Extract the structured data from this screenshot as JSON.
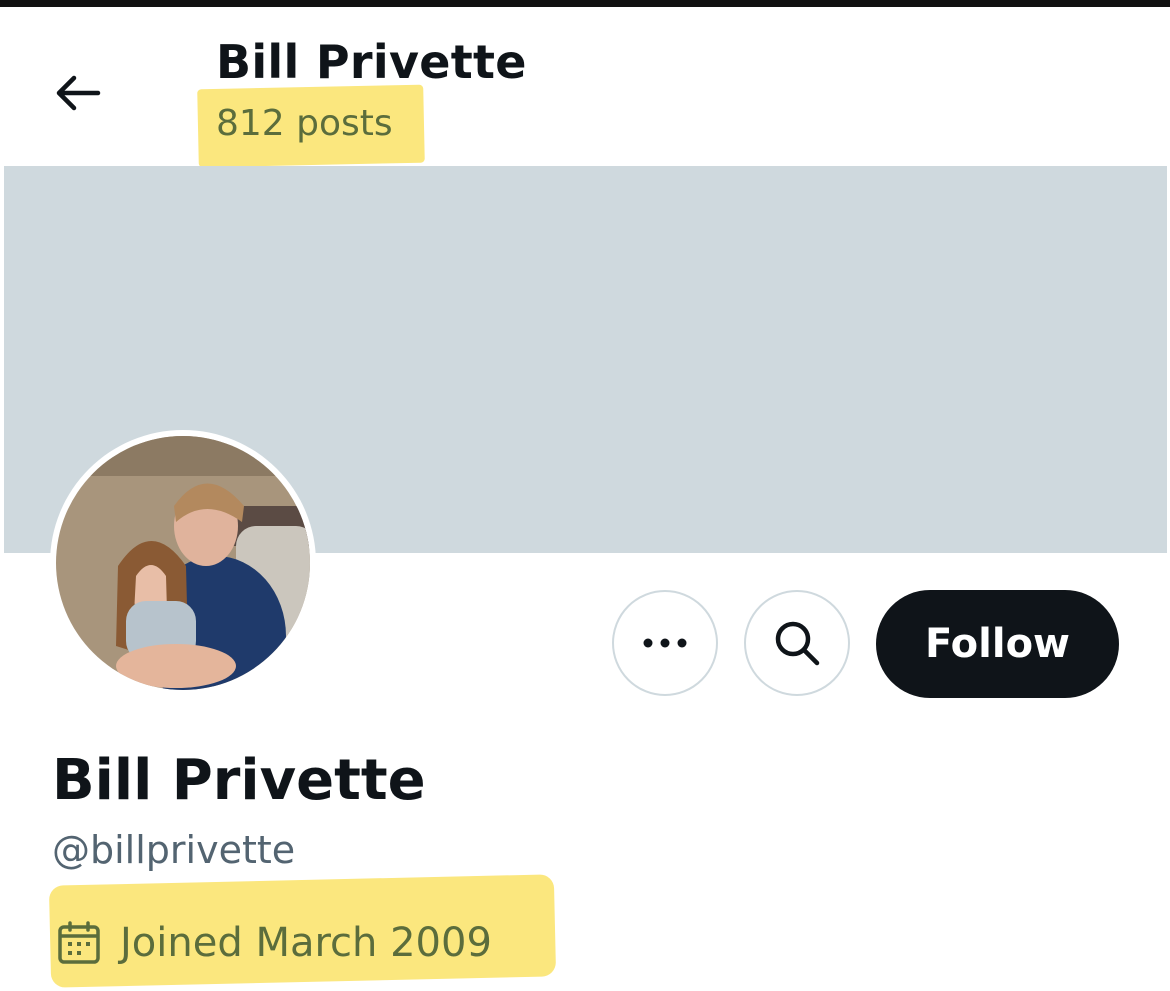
{
  "header": {
    "title": "Bill Privette",
    "posts_count": "812 posts"
  },
  "profile": {
    "name": "Bill Privette",
    "handle": "@billprivette",
    "joined": "Joined March 2009"
  },
  "actions": {
    "follow_label": "Follow"
  },
  "icons": {
    "back": "back-arrow-icon",
    "more": "more-options-icon",
    "search": "search-icon",
    "calendar": "calendar-icon"
  },
  "colors": {
    "banner": "#cfd9de",
    "follow_button": "#0f1419",
    "highlight": "#fbe77e",
    "secondary_text": "#536471"
  }
}
